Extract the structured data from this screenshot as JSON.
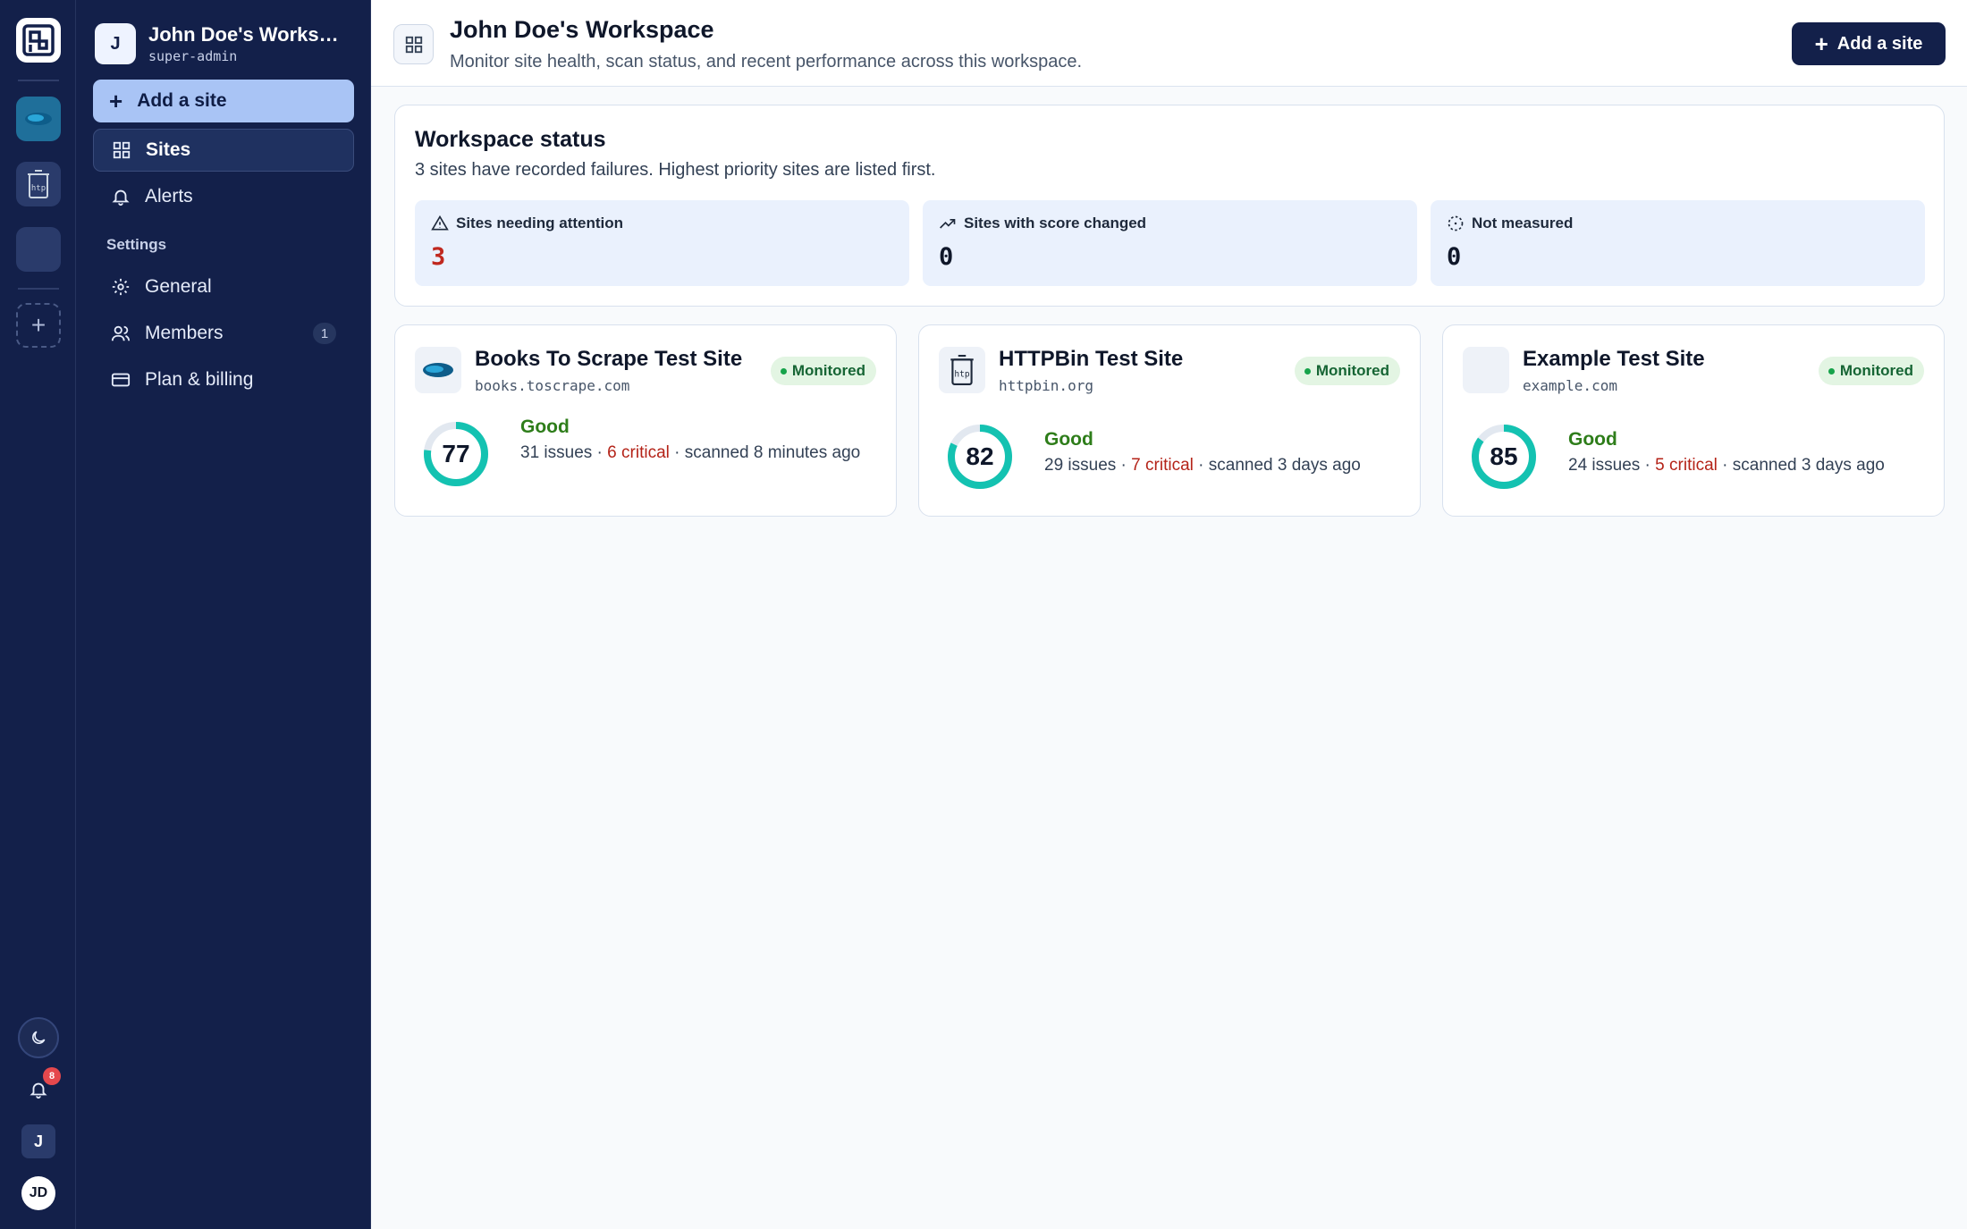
{
  "rail": {
    "notifications_count": "8",
    "workspace_initial": "J",
    "user_initials": "JD"
  },
  "sidebar": {
    "workspace_initial": "J",
    "workspace_name": "John Doe's Workspace",
    "role": "super-admin",
    "add_site_label": "Add a site",
    "nav": [
      {
        "label": "Sites",
        "icon": "grid-icon"
      },
      {
        "label": "Alerts",
        "icon": "bell-icon"
      }
    ],
    "settings_label": "Settings",
    "settings": [
      {
        "label": "General",
        "icon": "gear-icon"
      },
      {
        "label": "Members",
        "icon": "users-icon",
        "count": "1"
      },
      {
        "label": "Plan & billing",
        "icon": "card-icon"
      }
    ]
  },
  "header": {
    "title": "John Doe's Workspace",
    "subtitle": "Monitor site health, scan status, and recent performance across this workspace.",
    "add_site_label": "Add a site"
  },
  "status": {
    "title": "Workspace status",
    "description": "3 sites have recorded failures. Highest priority sites are listed first.",
    "stats": [
      {
        "label": "Sites needing attention",
        "value": "3",
        "color": "#c0281f",
        "icon": "alert-triangle-icon"
      },
      {
        "label": "Sites with score changed",
        "value": "0",
        "color": "#0f172a",
        "icon": "trending-up-icon"
      },
      {
        "label": "Not measured",
        "value": "0",
        "color": "#0f172a",
        "icon": "dashed-circle-icon"
      }
    ]
  },
  "sites": [
    {
      "name": "Books To Scrape Test Site",
      "domain": "books.toscrape.com",
      "status": "Monitored",
      "score": 77,
      "grade": "Good",
      "issues": "31 issues",
      "critical": "6 critical",
      "scanned": "scanned 8 minutes ago"
    },
    {
      "name": "HTTPBin Test Site",
      "domain": "httpbin.org",
      "status": "Monitored",
      "score": 82,
      "grade": "Good",
      "issues": "29 issues",
      "critical": "7 critical",
      "scanned": "scanned 3 days ago"
    },
    {
      "name": "Example Test Site",
      "domain": "example.com",
      "status": "Monitored",
      "score": 85,
      "grade": "Good",
      "issues": "24 issues",
      "critical": "5 critical",
      "scanned": "scanned 3 days ago"
    }
  ],
  "colors": {
    "navy": "#13204a",
    "accent": "#a9c4f5",
    "ring": "#14c2b1",
    "good": "#2e7d1a",
    "critical": "#b42318"
  }
}
